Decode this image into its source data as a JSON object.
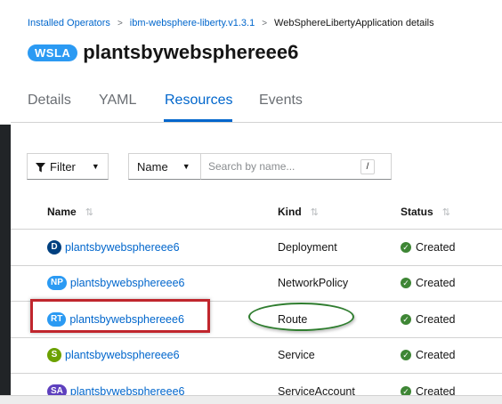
{
  "breadcrumb": {
    "items": [
      "Installed Operators",
      "ibm-websphere-liberty.v1.3.1"
    ],
    "separator": ">",
    "current": "WebSphereLibertyApplication details"
  },
  "header": {
    "badge": "WSLA",
    "title": "plantsbywebsphereee6"
  },
  "tabs": [
    {
      "label": "Details",
      "active": false
    },
    {
      "label": "YAML",
      "active": false
    },
    {
      "label": "Resources",
      "active": true
    },
    {
      "label": "Events",
      "active": false
    }
  ],
  "toolbar": {
    "filter_label": "Filter",
    "filter_icon": "filter-icon",
    "select_label": "Name",
    "search_placeholder": "Search by name...",
    "shortcut": "/"
  },
  "table": {
    "columns": [
      "Name",
      "Kind",
      "Status"
    ],
    "rows": [
      {
        "badge": "D",
        "badge_color": "#004080",
        "name": "plantsbywebsphereee6",
        "kind": "Deployment",
        "status": "Created"
      },
      {
        "badge": "NP",
        "badge_color": "#2b9af3",
        "name": "plantsbywebsphereee6",
        "kind": "NetworkPolicy",
        "status": "Created"
      },
      {
        "badge": "RT",
        "badge_color": "#2b9af3",
        "name": "plantsbywebsphereee6",
        "kind": "Route",
        "status": "Created"
      },
      {
        "badge": "S",
        "badge_color": "#6ca100",
        "name": "plantsbywebsphereee6",
        "kind": "Service",
        "status": "Created"
      },
      {
        "badge": "SA",
        "badge_color": "#5e40be",
        "name": "plantsbywebsphereee6",
        "kind": "ServiceAccount",
        "status": "Created"
      }
    ]
  },
  "colors": {
    "link": "#0066cc",
    "status_success": "#3e8635",
    "annotation_rect": "#c0262d",
    "annotation_ellipse": "#2f7d2f"
  }
}
